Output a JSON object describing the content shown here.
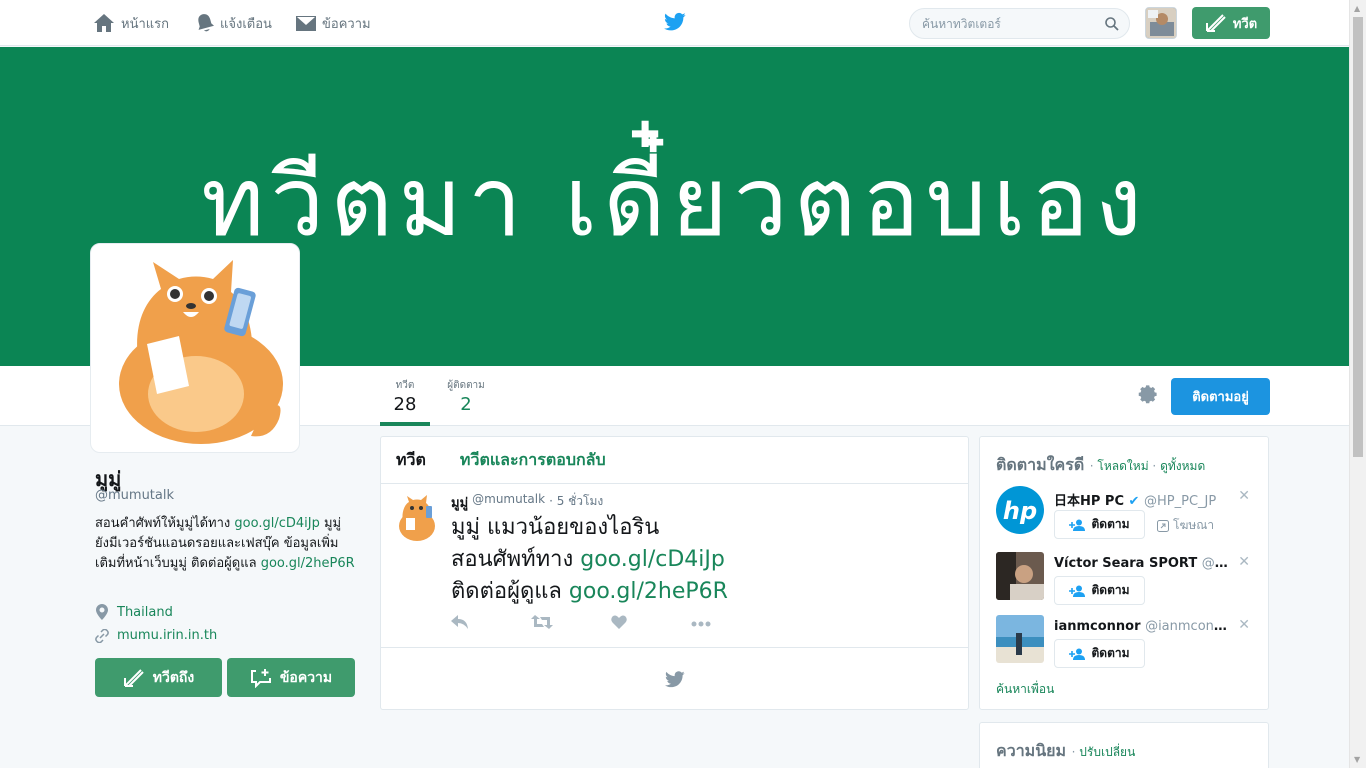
{
  "nav": {
    "home": "หน้าแรก",
    "notifications": "แจ้งเตือน",
    "messages": "ข้อความ",
    "search_placeholder": "ค้นหาทวิตเตอร์",
    "tweet_button": "ทวีต"
  },
  "banner": {
    "text": "ทวีตมา เดี๋ยวตอบเอง",
    "color": "#0b8554"
  },
  "profile": {
    "name": "มูมู่",
    "handle": "@mumutalk",
    "bio_1": "สอนคำศัพท์ให้มูมู่ได้ทาง ",
    "bio_link_1": "goo.gl/cD4iJp",
    "bio_2": " มูมู่ยังมีเวอร์ชันแอนดรอยและเฟสบุ๊ค ข้อมูลเพิ่มเติมที่หน้าเว็บมูมู่ ติดต่อผู้ดูแล ",
    "bio_link_2": "goo.gl/2heP6R",
    "location": "Thailand",
    "website": "mumu.irin.in.th",
    "tweet_to_button": "ทวีตถึง",
    "message_button": "ข้อความ"
  },
  "stats": {
    "tweets_label": "ทวีต",
    "tweets_value": "28",
    "followers_label": "ผู้ติดตาม",
    "followers_value": "2",
    "following_button": "ติดตามอยู่"
  },
  "timeline": {
    "tab_tweets": "ทวีต",
    "tab_replies": "ทวีตและการตอบกลับ",
    "tweet": {
      "name": "มูมู่",
      "handle": "@mumutalk",
      "time": "· 5 ชั่วโมง",
      "line1": "มูมู่ แมวน้อยของไอริน",
      "line2_text": "สอนศัพท์ทาง ",
      "line2_link": "goo.gl/cD4iJp",
      "line3_text": "ติดต่อผู้ดูแล ",
      "line3_link": "goo.gl/2heP6R"
    }
  },
  "who_to_follow": {
    "title": "ติดตามใครดี",
    "reload": "โหลดใหม่",
    "view_all": "ดูทั้งหมด",
    "sep": " · ",
    "follow_label": "ติดตาม",
    "promoted": "โฆษณา",
    "find_friends": "ค้นหาเพื่อน",
    "items": [
      {
        "name": "日本HP PC",
        "handle": "@HP_PC_JP"
      },
      {
        "name": "Víctor Seara SPORT",
        "handle": "@vicsea..."
      },
      {
        "name": "ianmconnor",
        "handle": "@ianmconnor"
      }
    ]
  },
  "trends": {
    "title": "ความนิยม",
    "change": "ปรับเปลี่ยน"
  },
  "colors": {
    "accent": "#19865a",
    "button_green": "#3f9b6d",
    "follow_blue": "#1c94e0"
  }
}
